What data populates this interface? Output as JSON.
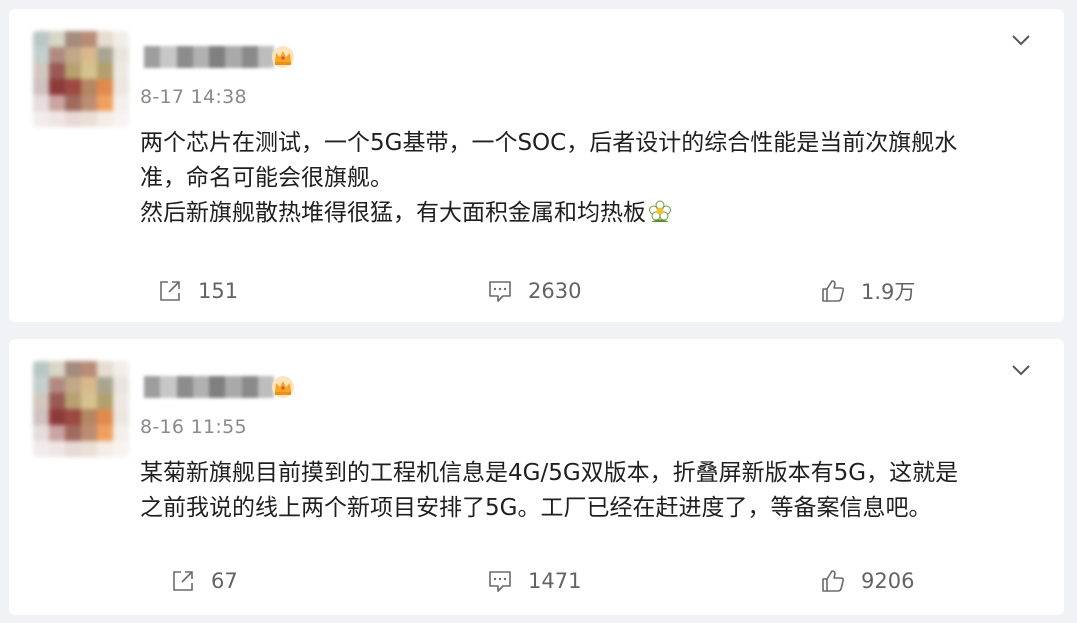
{
  "posts": [
    {
      "time": "8-17 14:38",
      "text_lines": [
        "两个芯片在测试，一个5G基带，一个SOC，后者设计的综合性能是当前次旗舰水",
        "准，命名可能会很旗舰。",
        "然后新旗舰散热堆得很猛，有大面积金属和均热板"
      ],
      "icons": [
        "vip-crown-icon",
        "flower-emoji-icon",
        "chevron-down-icon"
      ],
      "actions": {
        "share": "151",
        "comment": "2630",
        "like": "1.9万"
      }
    },
    {
      "time": "8-16 11:55",
      "text_lines": [
        "某菊新旗舰目前摸到的工程机信息是4G/5G双版本，折叠屏新版本有5G，这就是",
        "之前我说的线上两个新项目安排了5G。工厂已经在赶进度了，等备案信息吧。"
      ],
      "icons": [
        "vip-crown-icon",
        "chevron-down-icon"
      ],
      "actions": {
        "share": "67",
        "comment": "1471",
        "like": "9206"
      }
    }
  ],
  "colors": {
    "page_background": "#f1f2f5",
    "card_background": "#ffffff",
    "text": "#1f1f1f",
    "meta": "#8a8a8a",
    "action_text": "#636363",
    "crown": "#f5a623"
  }
}
